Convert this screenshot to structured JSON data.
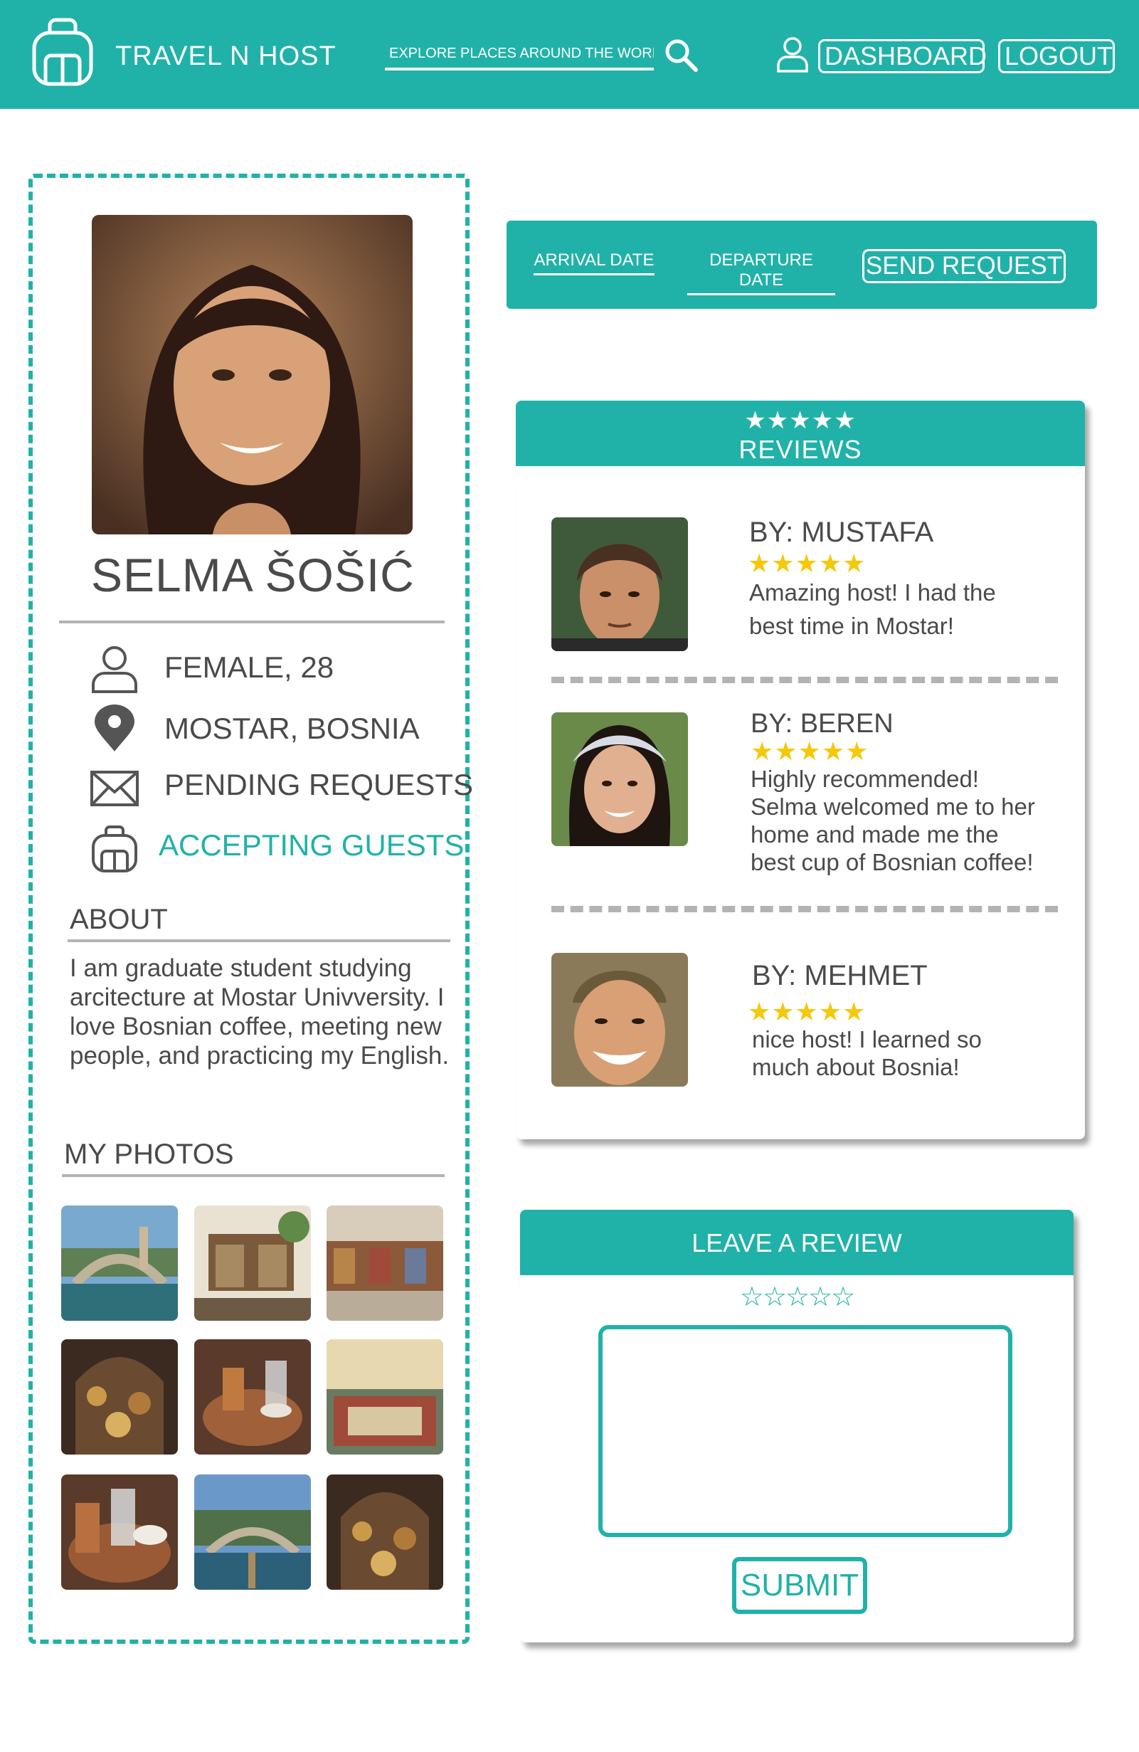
{
  "header": {
    "brand": "TRAVEL N HOST",
    "search_placeholder": "EXPLORE PLACES AROUND THE WORLD",
    "dashboard_label": "DASHBOARD",
    "logout_label": "LOGOUT"
  },
  "profile": {
    "name": "SELMA ŠOŠIĆ",
    "gender_age": "FEMALE, 28",
    "location": "MOSTAR, BOSNIA",
    "pending": "PENDING REQUESTS",
    "status": "ACCEPTING GUESTS",
    "about_title": "ABOUT",
    "about_text": "I am graduate student studying arcitecture at Mostar Univversity. I love Bosnian coffee, meeting new people, and practicing my English.",
    "photos_title": "MY PHOTOS"
  },
  "request": {
    "arrival_label": "ARRIVAL DATE",
    "departure_label": "DEPARTURE DATE",
    "send_label": "SEND REQUEST"
  },
  "reviews": {
    "header_stars": "★★★★★",
    "title": "REVIEWS",
    "items": [
      {
        "by": "BY: MUSTAFA",
        "stars": "★★★★★",
        "text": "Amazing host! I had the best time in Mostar!"
      },
      {
        "by": "BY: BEREN",
        "stars": "★★★★★",
        "text": "Highly recommended! Selma welcomed me to her home and made me the best cup of Bosnian coffee!"
      },
      {
        "by": "BY: MEHMET",
        "stars": "★★★★★",
        "text": "nice host! I learned so much about Bosnia!"
      }
    ]
  },
  "leave_review": {
    "title": "LEAVE A REVIEW",
    "rating_stars": "☆☆☆☆☆",
    "submit_label": "SUBMIT"
  },
  "colors": {
    "accent": "#20b2a8",
    "star": "#f5c80a",
    "text": "#4a4a4a",
    "divider": "#b3b3b3"
  }
}
